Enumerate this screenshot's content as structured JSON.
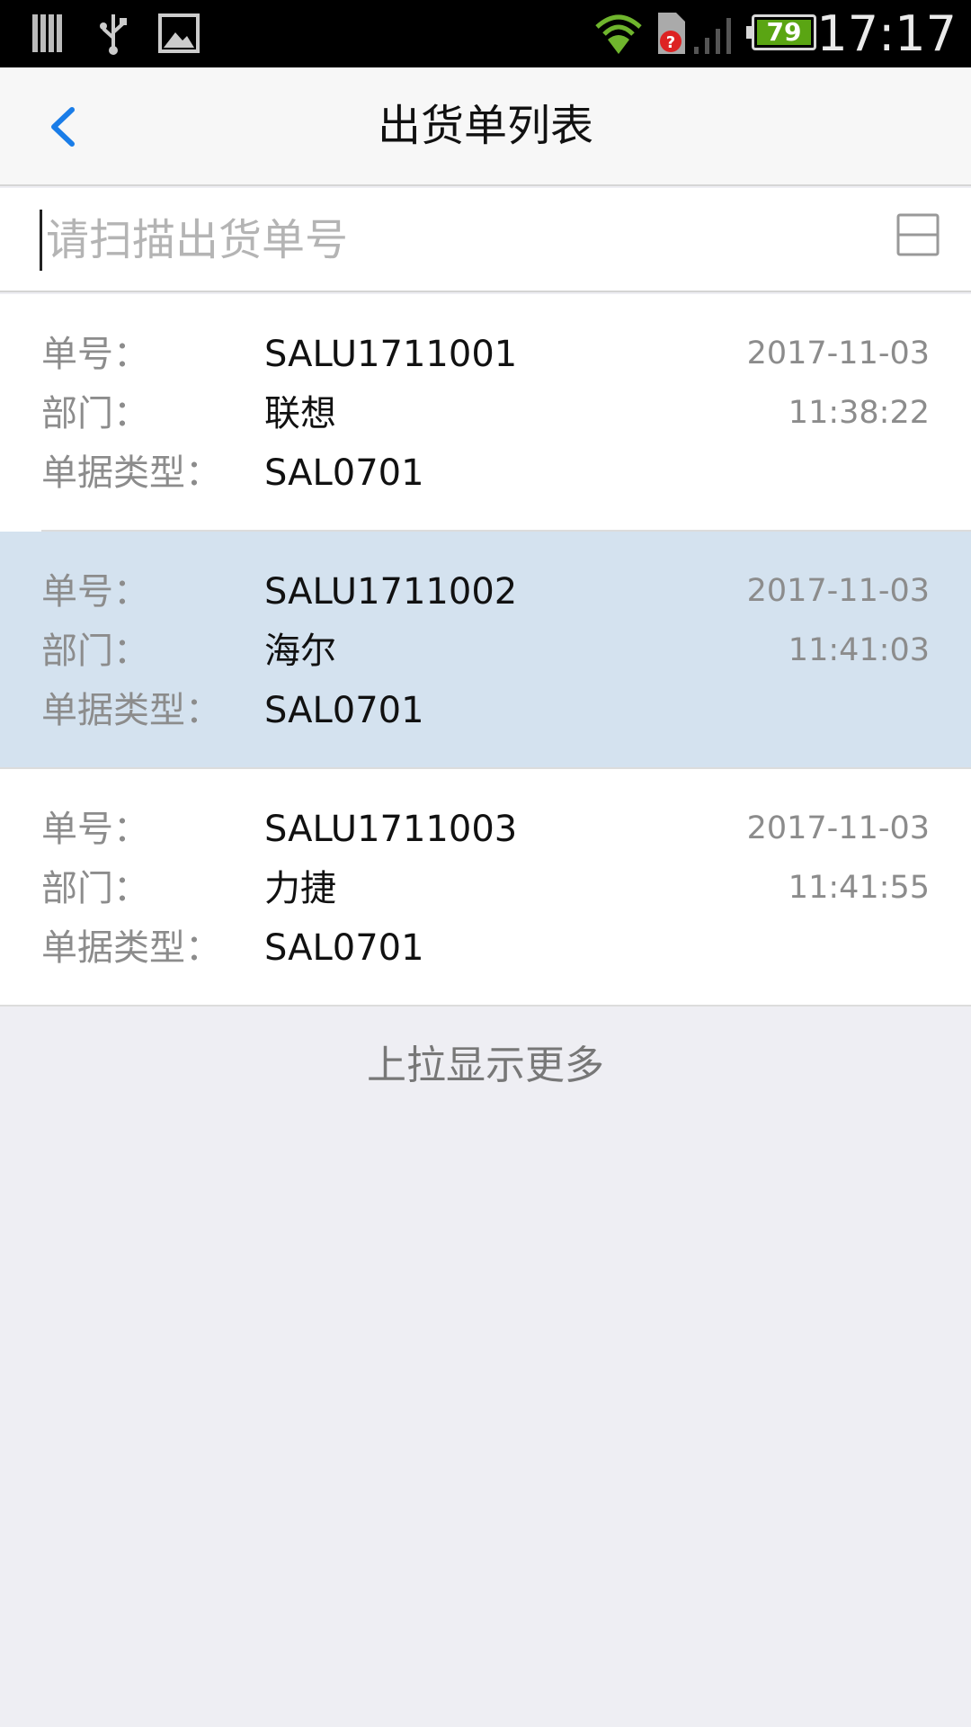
{
  "status_bar": {
    "time": "17:17",
    "battery": "79",
    "icons": [
      "signal-bars-icon",
      "usb-icon",
      "image-icon",
      "wifi-icon",
      "sim-error-icon",
      "cell-signal-icon",
      "battery-icon"
    ]
  },
  "header": {
    "back_icon": "chevron-left-icon",
    "title": "出货单列表"
  },
  "search": {
    "placeholder": "请扫描出货单号",
    "value": "",
    "scan_icon": "scan-icon"
  },
  "labels": {
    "order_no": "单号：",
    "department": "部门：",
    "doc_type": "单据类型："
  },
  "orders": [
    {
      "order_no": "SALU1711001",
      "department": "联想",
      "doc_type": "SAL0701",
      "date": "2017-11-03",
      "time": "11:38:22",
      "selected": false
    },
    {
      "order_no": "SALU1711002",
      "department": "海尔",
      "doc_type": "SAL0701",
      "date": "2017-11-03",
      "time": "11:41:03",
      "selected": true
    },
    {
      "order_no": "SALU1711003",
      "department": "力捷",
      "doc_type": "SAL0701",
      "date": "2017-11-03",
      "time": "11:41:55",
      "selected": false
    }
  ],
  "footer": {
    "load_more": "上拉显示更多"
  },
  "colors": {
    "accent": "#1a7de8",
    "selected_row": "#d4e2ef",
    "background": "#eeeef3"
  }
}
